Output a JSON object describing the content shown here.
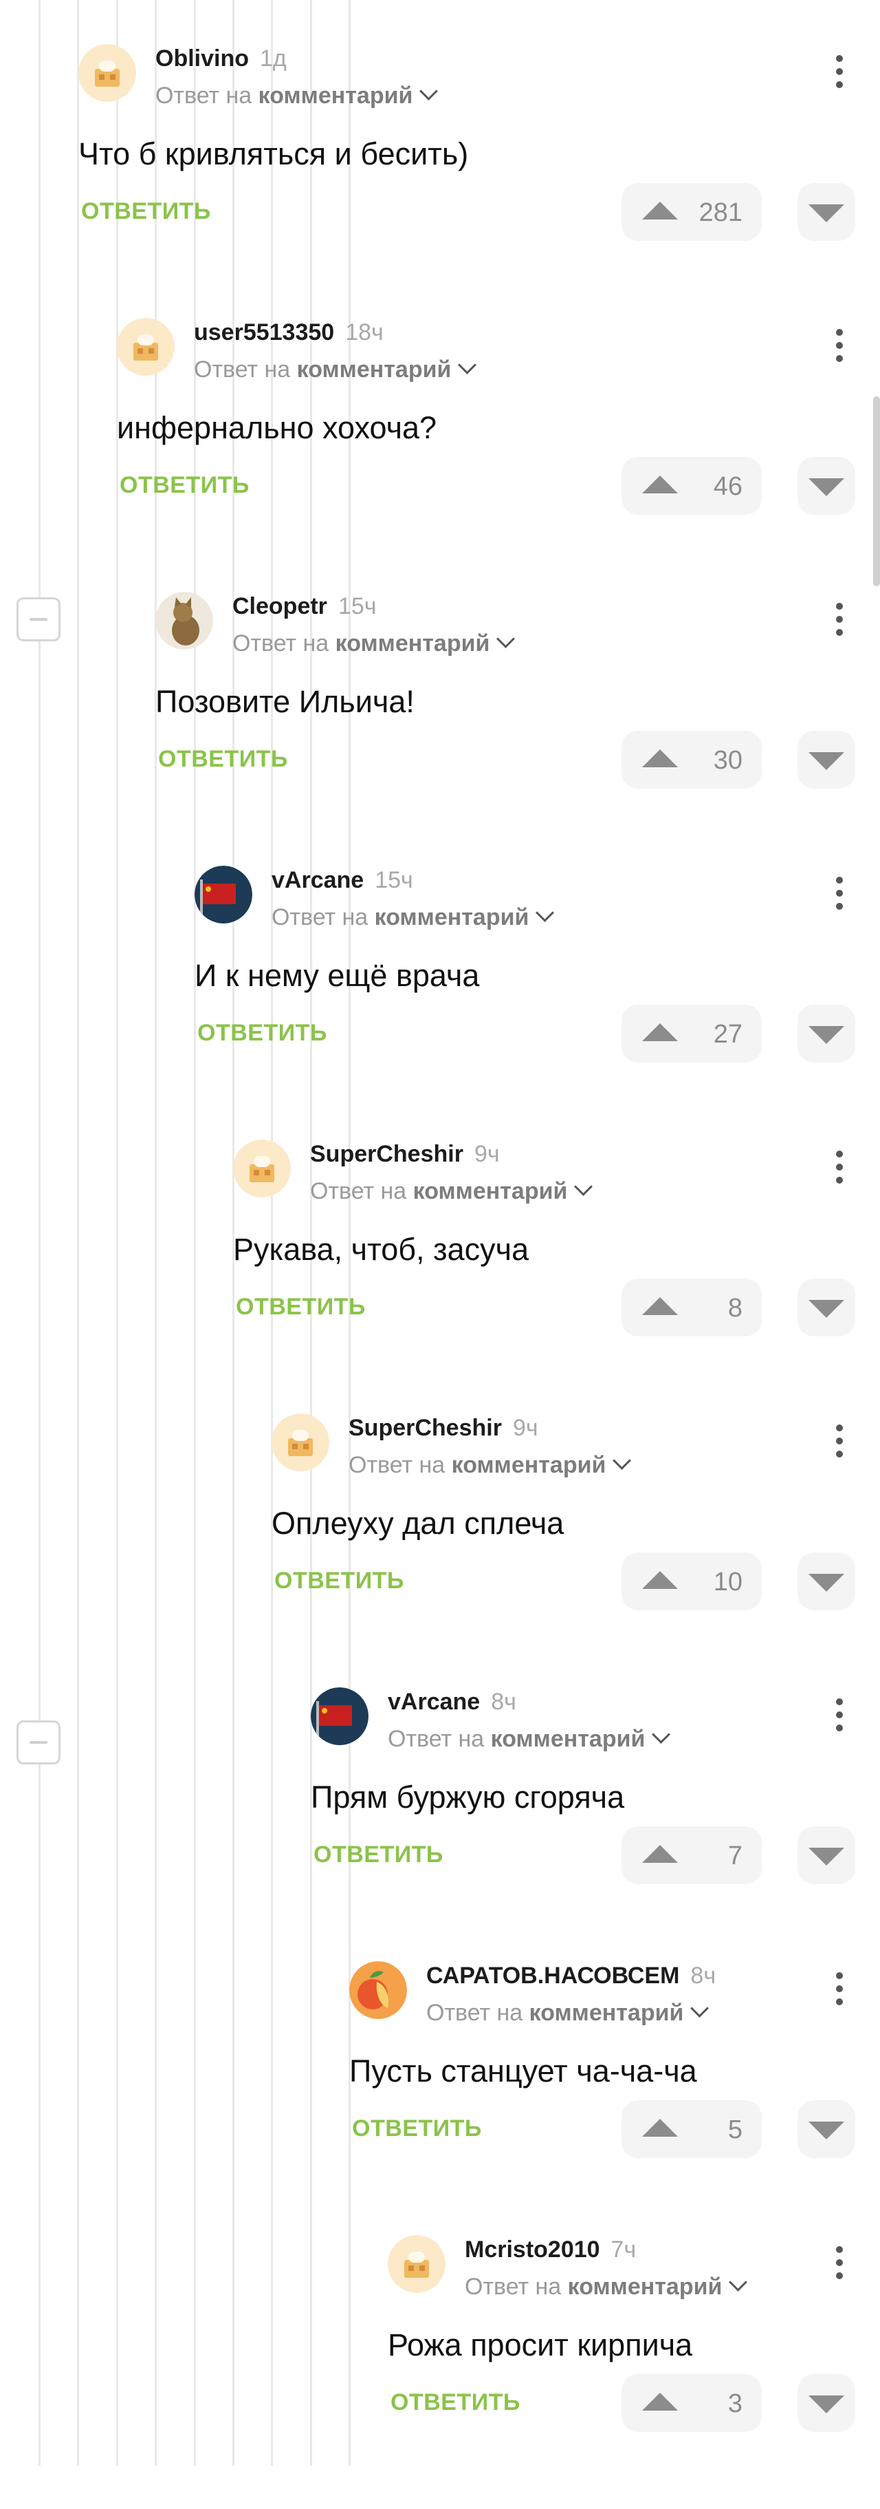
{
  "comments": [
    {
      "user": "Oblivino",
      "time": "1д",
      "reply_prefix": "Ответ на",
      "reply_target": "комментарий",
      "text": "Что б кривляться и бесить)",
      "reply_label": "ОТВЕТИТЬ",
      "rating": "281",
      "avatar": "stamp-avatar"
    },
    {
      "user": "user5513350",
      "time": "18ч",
      "reply_prefix": "Ответ на",
      "reply_target": "комментарий",
      "text": "инфернально хохоча?",
      "reply_label": "ОТВЕТИТЬ",
      "rating": "46",
      "avatar": "stamp-avatar"
    },
    {
      "user": "Cleopetr",
      "time": "15ч",
      "reply_prefix": "Ответ на",
      "reply_target": "комментарий",
      "text": "Позовите Ильича!",
      "reply_label": "ОТВЕТИТЬ",
      "rating": "30",
      "avatar": "cat-avatar"
    },
    {
      "user": "vArcane",
      "time": "15ч",
      "reply_prefix": "Ответ на",
      "reply_target": "комментарий",
      "text": "И к нему ещё врача",
      "reply_label": "ОТВЕТИТЬ",
      "rating": "27",
      "avatar": "flag-avatar"
    },
    {
      "user": "SuperCheshir",
      "time": "9ч",
      "reply_prefix": "Ответ на",
      "reply_target": "комментарий",
      "text": "Рукава, чтоб, засуча",
      "reply_label": "ОТВЕТИТЬ",
      "rating": "8",
      "avatar": "stamp-avatar"
    },
    {
      "user": "SuperCheshir",
      "time": "9ч",
      "reply_prefix": "Ответ на",
      "reply_target": "комментарий",
      "text": "Оплеуху дал сплеча",
      "reply_label": "ОТВЕТИТЬ",
      "rating": "10",
      "avatar": "stamp-avatar"
    },
    {
      "user": "vArcane",
      "time": "8ч",
      "reply_prefix": "Ответ на",
      "reply_target": "комментарий",
      "text": "Прям буржую сгоряча",
      "reply_label": "ОТВЕТИТЬ",
      "rating": "7",
      "avatar": "flag-avatar"
    },
    {
      "user": "САРАТОВ.НАСОВСЕМ",
      "time": "8ч",
      "reply_prefix": "Ответ на",
      "reply_target": "комментарий",
      "text": "Пусть станцует ча-ча-ча",
      "reply_label": "ОТВЕТИТЬ",
      "rating": "5",
      "avatar": "fruit-avatar"
    },
    {
      "user": "Mcristo2010",
      "time": "7ч",
      "reply_prefix": "Ответ на",
      "reply_target": "комментарий",
      "text": "Рожа просит кирпича",
      "reply_label": "ОТВЕТИТЬ",
      "rating": "3",
      "avatar": "stamp-avatar"
    }
  ],
  "colors": {
    "reply_green": "#8bc34a",
    "vote_bg": "#f4f4f4",
    "thread_line": "#e8e8e8"
  }
}
